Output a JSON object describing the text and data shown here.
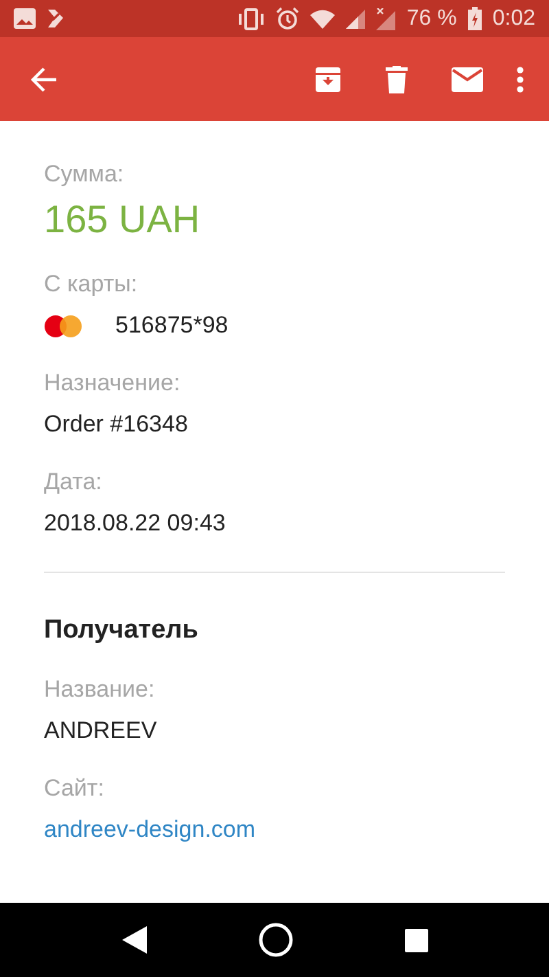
{
  "status_bar": {
    "battery_text": "76 %",
    "time": "0:02"
  },
  "payment": [
    {
      "kind": "amount",
      "label": "Сумма:",
      "value": "165 UAH"
    },
    {
      "kind": "card",
      "label": "С карты:",
      "value": "516875*98"
    },
    {
      "kind": "text",
      "label": "Назначение:",
      "value": "Order #16348"
    },
    {
      "kind": "text",
      "label": "Дата:",
      "value": "2018.08.22 09:43"
    }
  ],
  "recipient": {
    "heading": "Получатель",
    "fields": [
      {
        "kind": "text",
        "label": "Название:",
        "value": "ANDREEV"
      },
      {
        "kind": "link",
        "label": "Сайт:",
        "value": "andreev-design.com"
      }
    ]
  }
}
